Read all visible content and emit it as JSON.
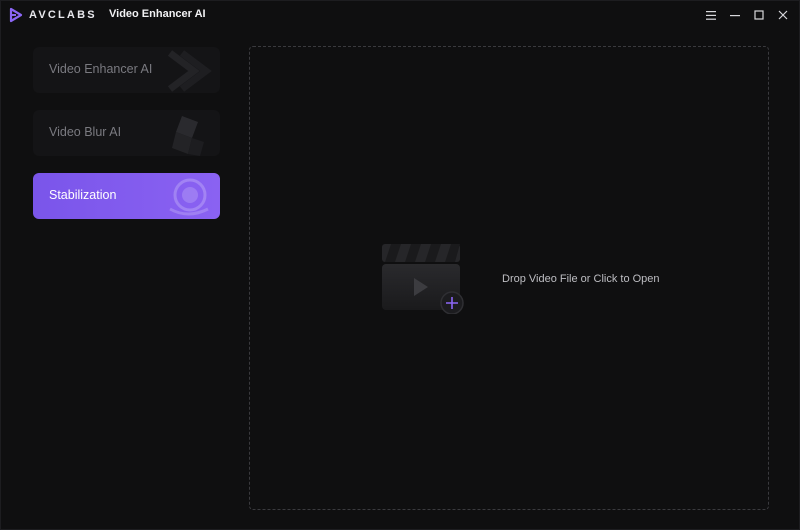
{
  "titlebar": {
    "brand": "AVCLABS",
    "app_title": "Video Enhancer AI",
    "controls": {
      "menu_icon": "hamburger-icon",
      "minimize_icon": "minimize-icon",
      "maximize_icon": "maximize-icon",
      "close_icon": "close-icon"
    }
  },
  "sidebar": {
    "items": [
      {
        "label": "Video Enhancer AI",
        "icon": "enhancer-chevrons-icon",
        "active": false
      },
      {
        "label": "Video Blur AI",
        "icon": "blur-cube-icon",
        "active": false
      },
      {
        "label": "Stabilization",
        "icon": "stabilization-lens-icon",
        "active": true
      }
    ]
  },
  "dropzone": {
    "prompt": "Drop Video File or Click to Open",
    "icon": "clapperboard-add-icon"
  },
  "colors": {
    "background": "#0f0f10",
    "accent": "#7a55ea",
    "inactive_item": "#141416",
    "inactive_text": "#7a7a80"
  }
}
